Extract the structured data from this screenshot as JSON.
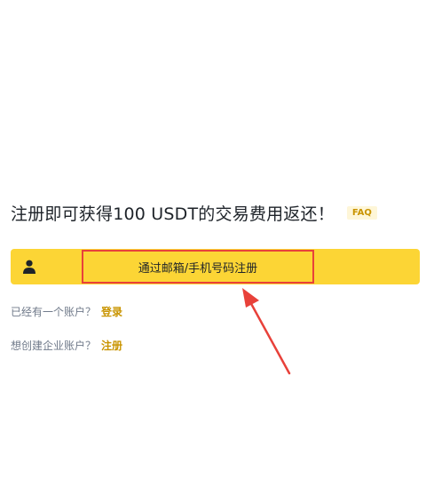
{
  "headline": {
    "text": "注册即可获得100 USDT的交易费用返还！",
    "faq": "FAQ"
  },
  "register": {
    "icon": "user-icon",
    "label": "通过邮箱/手机号码注册"
  },
  "login_line": {
    "prompt": "已经有一个账户？",
    "link": "登录"
  },
  "business_line": {
    "prompt": "想创建企业账户？",
    "link": "注册"
  },
  "colors": {
    "accent": "#fcd535",
    "link": "#c99400",
    "annotation": "#e8413a"
  }
}
